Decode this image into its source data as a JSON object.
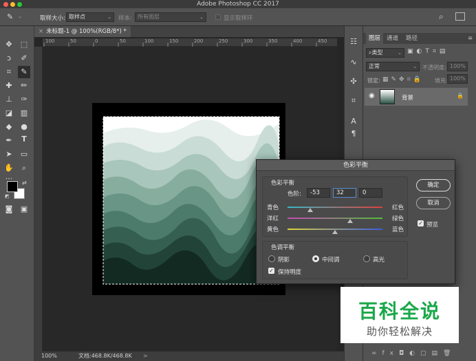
{
  "app": {
    "title": "Adobe Photoshop CC 2017"
  },
  "options": {
    "sample_size_label": "取样大小:",
    "sample_size_value": "取样点",
    "sample_label": "样本:",
    "sample_value": "所有图层",
    "show_ring_label": "显示取样环"
  },
  "document": {
    "tab_title": "未标题-1 @ 100%(RGB/8*) *",
    "ruler_ticks": [
      "100",
      "50",
      "0",
      "50",
      "100",
      "150",
      "200",
      "250",
      "300",
      "350",
      "400",
      "450"
    ]
  },
  "status": {
    "zoom": "100%",
    "doc_info": "文档:468.8K/468.8K"
  },
  "layers_panel": {
    "tabs": [
      "图层",
      "通道",
      "路径"
    ],
    "kind_filter": "类型",
    "blend_mode": "正常",
    "opacity_label": "不透明度:",
    "opacity_value": "100%",
    "lock_label": "锁定:",
    "fill_label": "填充:",
    "fill_value": "100%",
    "layer_name": "背景"
  },
  "dialog": {
    "title": "色彩平衡",
    "balance_group": "色彩平衡",
    "levels_label": "色阶:",
    "levels": [
      "-53",
      "32",
      "0"
    ],
    "sliders": [
      {
        "left": "青色",
        "right": "红色",
        "value": -53,
        "color": "#e0403a"
      },
      {
        "left": "洋红",
        "right": "绿色",
        "value": 32,
        "color": "#4fbf3a"
      },
      {
        "left": "黄色",
        "right": "蓝色",
        "value": 0,
        "color": "#3a5de0"
      }
    ],
    "tone_group": "色调平衡",
    "tones": [
      "阴影",
      "中间调",
      "高光"
    ],
    "selected_tone": "中间调",
    "preserve_label": "保持明度",
    "ok_label": "确定",
    "cancel_label": "取消",
    "preview_label": "预览"
  },
  "watermark": {
    "main": "百科全说",
    "sub": "助你轻松解决"
  }
}
